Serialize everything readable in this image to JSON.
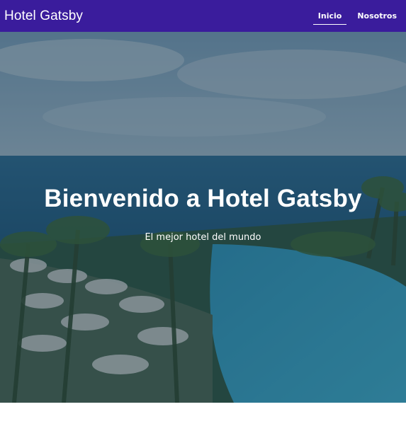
{
  "header": {
    "brand": "Hotel Gatsby",
    "nav": [
      {
        "label": "Inicio",
        "active": true
      },
      {
        "label": "Nosotros",
        "active": false
      }
    ]
  },
  "hero": {
    "title": "Bienvenido a Hotel Gatsby",
    "subtitle": "El mejor hotel del mundo",
    "image": "resort-pool-ocean-photo"
  },
  "colors": {
    "navbar": "#3a1c9c",
    "text": "#ffffff"
  }
}
